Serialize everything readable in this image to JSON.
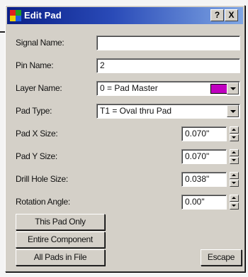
{
  "window": {
    "title": "Edit Pad",
    "help_label": "?",
    "close_label": "X",
    "icon": "app-icon"
  },
  "fields": {
    "signal_name": {
      "label": "Signal Name:",
      "value": ""
    },
    "pin_name": {
      "label": "Pin Name:",
      "value": "2"
    },
    "layer_name": {
      "label": "Layer Name:",
      "value": "0 = Pad Master",
      "swatch_color": "#c000c0"
    },
    "pad_type": {
      "label": "Pad Type:",
      "value": "T1 = Oval thru Pad"
    },
    "pad_x_size": {
      "label": "Pad X Size:",
      "value": "0.070\""
    },
    "pad_y_size": {
      "label": "Pad Y Size:",
      "value": "0.070\""
    },
    "drill_hole_size": {
      "label": "Drill Hole Size:",
      "value": "0.038\""
    },
    "rotation_angle": {
      "label": "Rotation Angle:",
      "value": "0.00\""
    }
  },
  "buttons": {
    "this_pad_only": "This Pad Only",
    "entire_component": "Entire Component",
    "all_pads_in_file": "All Pads in File",
    "escape": "Escape"
  }
}
